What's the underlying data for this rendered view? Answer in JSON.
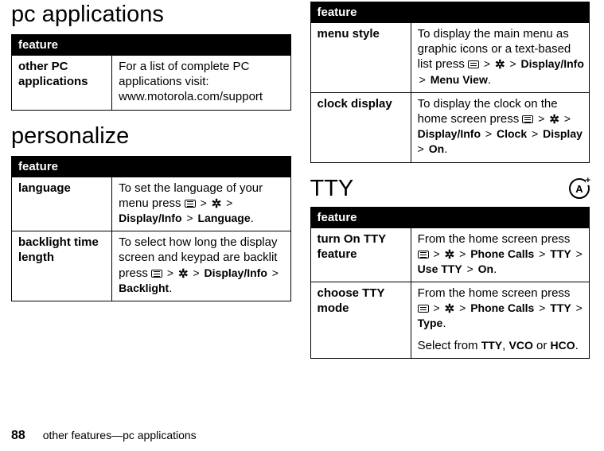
{
  "sections": {
    "pc_applications": {
      "heading": "pc applications",
      "table_header": "feature",
      "rows": [
        {
          "name": "other PC applications",
          "desc_pre": "For a list of complete PC applications visit: www.motorola.com/support"
        }
      ]
    },
    "personalize": {
      "heading": "personalize",
      "table_header": "feature",
      "rows": [
        {
          "name": "language",
          "desc_pre": "To set the language of your menu press ",
          "path": [
            [
              "menu-icon"
            ],
            ">",
            [
              "tools-icon"
            ],
            ">",
            "Display/Info",
            ">",
            "Language"
          ],
          "desc_post": "."
        },
        {
          "name": "backlight time length",
          "desc_pre": "To select how long the display screen and keypad are backlit press ",
          "path": [
            [
              "menu-icon"
            ],
            ">",
            [
              "tools-icon"
            ],
            ">",
            "Display/Info",
            ">",
            "Backlight"
          ],
          "desc_post": "."
        }
      ]
    },
    "personalize2": {
      "table_header": "feature",
      "rows": [
        {
          "name": "menu style",
          "desc_pre": "To display the main menu as graphic icons or a text-based list press ",
          "path": [
            [
              "menu-icon"
            ],
            ">",
            [
              "tools-icon"
            ],
            ">",
            "Display/Info",
            ">",
            "Menu View"
          ],
          "desc_post": "."
        },
        {
          "name": "clock display",
          "desc_pre": "To display the clock on the home screen press ",
          "path": [
            [
              "menu-icon"
            ],
            ">",
            [
              "tools-icon"
            ],
            ">",
            "Display/Info",
            ">",
            "Clock",
            ">",
            "Display",
            ">",
            "On"
          ],
          "desc_post": "."
        }
      ]
    },
    "tty": {
      "heading": "TTY",
      "badge": "A",
      "table_header": "feature",
      "rows": [
        {
          "name": "turn On TTY feature",
          "desc_pre": "From the home screen press ",
          "path": [
            [
              "menu-icon"
            ],
            ">",
            [
              "tools-icon"
            ],
            ">",
            "Phone Calls",
            ">",
            "TTY",
            ">",
            "Use TTY",
            ">",
            "On"
          ],
          "desc_post": "."
        },
        {
          "name": "choose TTY mode",
          "desc_pre": "From the home screen press ",
          "path": [
            [
              "menu-icon"
            ],
            ">",
            [
              "tools-icon"
            ],
            ">",
            "Phone Calls",
            ">",
            "TTY",
            ">",
            "Type"
          ],
          "desc_post": ".",
          "extra_line_pre": "Select from ",
          "extra_opts": [
            "TTY",
            "VCO",
            "HCO"
          ],
          "extra_line_post": "."
        }
      ]
    }
  },
  "footer": {
    "page_number": "88",
    "footer_text": "other features—pc applications"
  }
}
